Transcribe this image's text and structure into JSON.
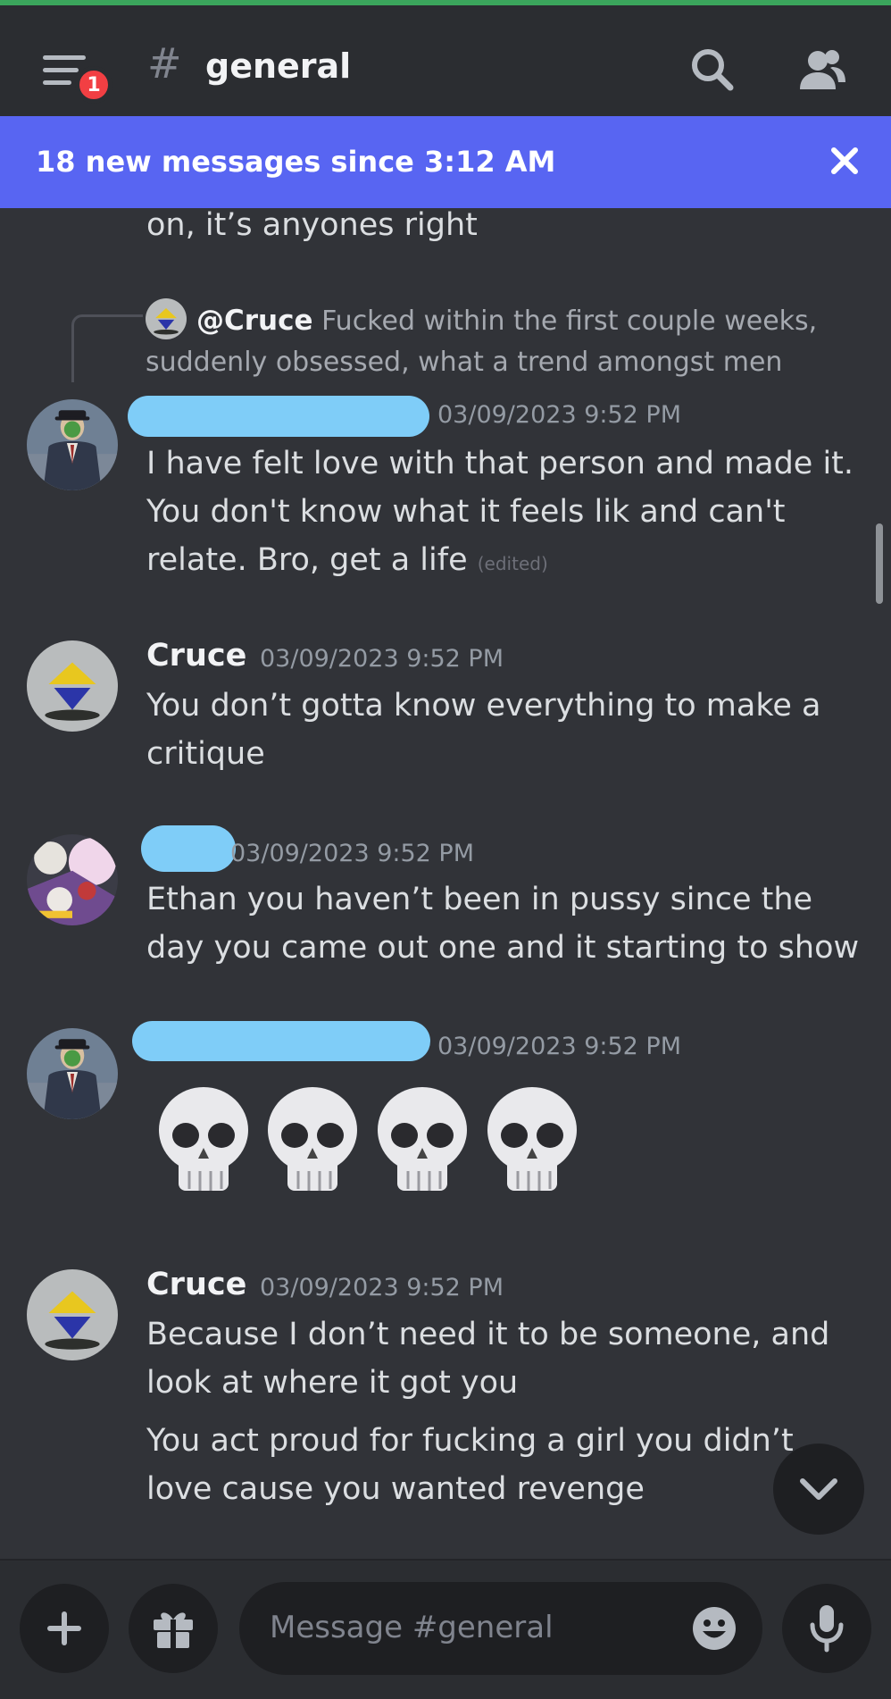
{
  "header": {
    "menu_badge": "1",
    "hash": "#",
    "channel": "general"
  },
  "banner": {
    "text": "18 new messages since 3:12 AM"
  },
  "messages": [
    {
      "text": "on, it’s anyones right"
    },
    {
      "reply": {
        "mention": "@Cruce",
        "text": "Fucked within the first couple weeks, suddenly obsessed, what a trend amongst men"
      }
    },
    {
      "timestamp": "03/09/2023 9:52 PM",
      "text": "I have felt love with that person and made it. You don't know what it feels lik and can't relate. Bro, get a life",
      "edited": "(edited)"
    },
    {
      "author": "Cruce",
      "timestamp": "03/09/2023 9:52 PM",
      "text": "You don’t gotta know everything to make a critique"
    },
    {
      "timestamp": "03/09/2023 9:52 PM",
      "text": "Ethan you haven’t been in pussy since the day you came out one and it starting to show"
    },
    {
      "timestamp": "03/09/2023 9:52 PM",
      "emoji_name": "skull-emoji",
      "emoji_count": 4
    },
    {
      "author": "Cruce",
      "timestamp": "03/09/2023 9:52 PM",
      "text": "Because I don’t need it to be someone, and look at where it got you",
      "text2": "You act proud for fucking a girl you didn’t love cause you wanted revenge"
    }
  ],
  "composer": {
    "placeholder": "Message #general"
  },
  "colors": {
    "background": "#313338",
    "header": "#2b2d31",
    "banner": "#5865f2",
    "badge": "#f23f43",
    "top_line": "#3ba55c",
    "redaction": "#7fcdf8"
  },
  "icons": [
    "menu-icon",
    "search-icon",
    "members-icon",
    "close-icon",
    "chevron-down-icon",
    "plus-icon",
    "gift-icon",
    "emoji-icon",
    "microphone-icon"
  ]
}
